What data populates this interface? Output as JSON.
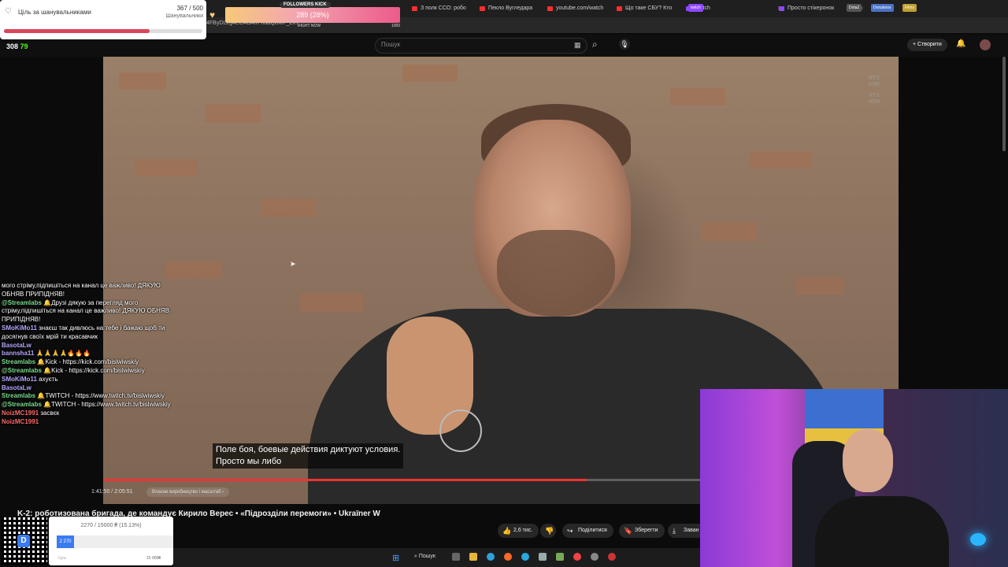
{
  "browser": {
    "tabs": [
      {
        "label": "З полк ССО: робо",
        "color": "#ff2d2d"
      },
      {
        "label": "Пекло Вугледара",
        "color": "#ff2d2d"
      },
      {
        "label": "youtube.com/watch",
        "color": "#ff2d2d"
      },
      {
        "label": "Що таке СБУ? Кто",
        "color": "#ff2d2d"
      },
      {
        "label": "Twitch",
        "color": "#9146ff"
      },
      {
        "label": "Просто стікеронок",
        "color": "#9146ff"
      }
    ],
    "bookmark_chips": [
      "twitch",
      "Dota2",
      "Donations",
      "Films"
    ],
    "url_fragment": "4FByDL2g4ECABAIK-ndaQBMF_ZxY"
  },
  "youtube": {
    "search_placeholder": "Пошук",
    "create_label": "Створити",
    "video_title": "K-2: роботизована бригада, де командує Кирило Верес • «Підрозділи перемоги» • Ukraïner W",
    "subtitle_line1": "Поле боя, боевые действия диктуют условия.",
    "subtitle_line2": "Просто мы либо",
    "time": "1:41:50 / 2:05:51",
    "chapter": "Власне виробництво і масштаб",
    "progress": 0.81,
    "likes": "2,6 тис.",
    "share_label": "Поділитися",
    "save_label": "Зберегти",
    "download_label": "Заван",
    "rtx_badge_1": "RTX VSR",
    "rtx_badge_2": "RTX HDR"
  },
  "overlays": {
    "goal": {
      "label": "Ціль за шанувальниками",
      "current": "367",
      "max": "500",
      "sub": "Шанувальники"
    },
    "followers": {
      "title": "FOLLOWERS KICK",
      "value": "289 (28%)",
      "right_now": "RIGHT NOW",
      "max": "1000"
    },
    "viewers": "308",
    "viewers_2": "79",
    "donation": {
      "title": "2270 / 15000 ₴ (15.13%)",
      "fill_label": "2 270",
      "goal_label": "Ціль",
      "max_label": "15 000₴",
      "fraction": 0.1513
    }
  },
  "chat": [
    {
      "user": "",
      "text": "мого стріму,підпишіться на канал це важливо! ДЯКУЮ ОБНЯВ ПРИПІДНЯВ!",
      "cls": ""
    },
    {
      "user": "@Streamlabs",
      "text": "🔔Друзі дякую за перегляд мого стріму,підпишіться на канал це важливо! ДЯКУЮ ОБНЯВ ПРИПІДНЯВ!",
      "cls": "green"
    },
    {
      "user": "SMoKiMo11",
      "text": "знаєш так дивлюсь на тебе і бажаю щоб ти досягнув своїх мрій ти красавчик",
      "cls": ""
    },
    {
      "user": "BasotaLw",
      "text": "",
      "cls": ""
    },
    {
      "user": "bannsha11",
      "text": "🙏🙏🙏🙏🔥🔥🔥",
      "cls": ""
    },
    {
      "user": "Streamlabs",
      "text": "🔔Kick - https://kick.com/bislwiwskiy",
      "cls": "green"
    },
    {
      "user": "@Streamlabs",
      "text": "🔔Kick - https://kick.com/bislwiwskiy",
      "cls": "green"
    },
    {
      "user": "SMoKiMo11",
      "text": "ахуєть",
      "cls": ""
    },
    {
      "user": "BasotaLw",
      "text": "",
      "cls": ""
    },
    {
      "user": "Streamlabs",
      "text": "🔔TWITCH - https://www.twitch.tv/bislwiwskiy",
      "cls": "green"
    },
    {
      "user": "@Streamlabs",
      "text": "🔔TWITCH - https://www.twitch.tv/bislwiwskiy",
      "cls": "green"
    },
    {
      "user": "NoizMC1991",
      "text": "засвєк",
      "cls": "red"
    },
    {
      "user": "NoizMC1991",
      "text": "",
      "cls": "red"
    }
  ],
  "taskbar": {
    "search_label": "Пошук"
  }
}
